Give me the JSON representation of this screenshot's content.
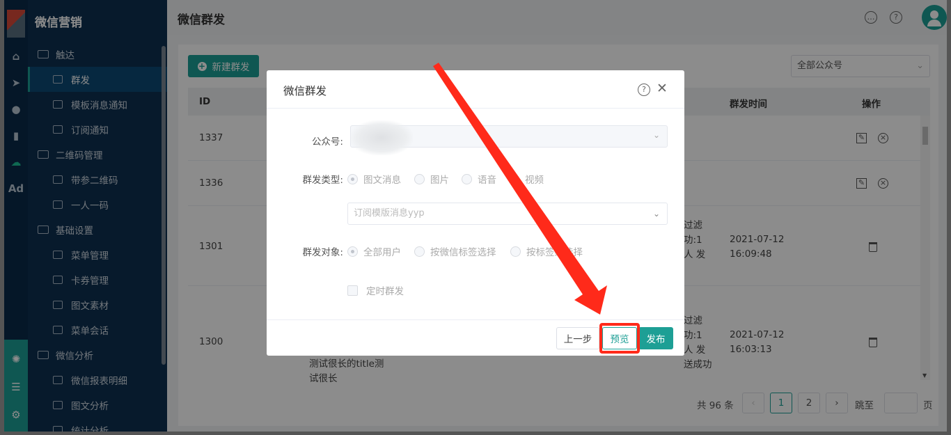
{
  "app": {
    "title": "微信营销"
  },
  "colors": {
    "accent": "#1d9f95",
    "sidebar": "#0d3050",
    "annotation": "#ff2a1a"
  },
  "rail_icons": [
    "home-icon",
    "send-icon",
    "user-icon",
    "chart-icon",
    "wechat-icon",
    "ad-icon",
    "settings-cluster-icon",
    "server-icon",
    "gear-icon"
  ],
  "rail_ad": "Ad",
  "sidebar": {
    "groups": [
      {
        "label": "触达",
        "items": [
          {
            "label": "群发",
            "active": true
          },
          {
            "label": "模板消息通知"
          },
          {
            "label": "订阅通知"
          }
        ]
      },
      {
        "label": "二维码管理",
        "items": [
          {
            "label": "带参二维码"
          },
          {
            "label": "一人一码"
          }
        ]
      },
      {
        "label": "基础设置",
        "items": [
          {
            "label": "菜单管理"
          },
          {
            "label": "卡券管理"
          },
          {
            "label": "图文素材"
          },
          {
            "label": "菜单会话"
          }
        ]
      },
      {
        "label": "微信分析",
        "items": [
          {
            "label": "微信报表明细"
          },
          {
            "label": "图文分析"
          },
          {
            "label": "统计分析"
          }
        ]
      }
    ]
  },
  "header": {
    "title": "微信群发"
  },
  "toolbar": {
    "new_label": "新建群发",
    "account_select": "全部公众号"
  },
  "table": {
    "headers": {
      "id": "ID",
      "time": "群发时间",
      "ops": "操作"
    },
    "rows": [
      {
        "id": "1337"
      },
      {
        "id": "1336"
      },
      {
        "id": "1301",
        "status": [
          "过滤",
          "功:1",
          "人 发"
        ],
        "time": [
          "2021-07-12",
          "16:09:48"
        ]
      },
      {
        "id": "1300",
        "status": [
          "过滤",
          "功:1",
          "人 发",
          "送成功"
        ],
        "time": [
          "2021-07-12",
          "16:03:13"
        ],
        "content": [
          "测试很长的title测",
          "试很长"
        ]
      }
    ]
  },
  "pagination": {
    "total": "共 96 条",
    "pages": [
      "1",
      "2"
    ],
    "prev": "‹",
    "next": "›",
    "goto": "跳至",
    "page_unit": "页"
  },
  "modal": {
    "title": "微信群发",
    "fields": {
      "account_label": "公众号:",
      "type_label": "群发类型:",
      "type_options": [
        "图文消息",
        "图片",
        "语音",
        "视频"
      ],
      "template_placeholder": "订阅模版消息yyp",
      "target_label": "群发对象:",
      "target_options": [
        "全部用户",
        "按微信标签选择",
        "按标签组选择"
      ],
      "scheduled_label": "定时群发"
    },
    "buttons": {
      "prev": "上一步",
      "preview": "预览",
      "publish": "发布"
    }
  }
}
